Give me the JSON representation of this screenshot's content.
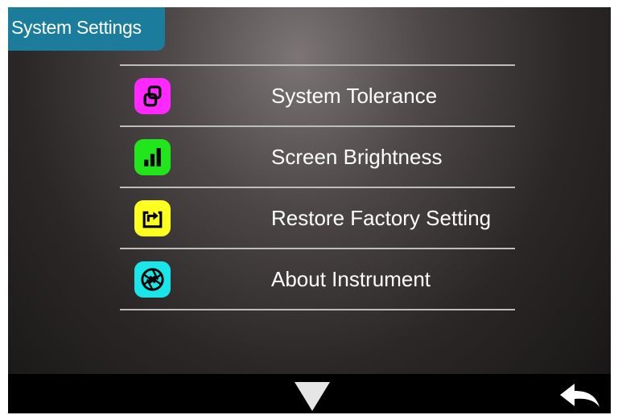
{
  "header": {
    "title": "System Settings"
  },
  "menu": {
    "items": [
      {
        "label": "System Tolerance",
        "icon": "tolerance-icon",
        "color": "#ff28ff"
      },
      {
        "label": "Screen Brightness",
        "icon": "brightness-bars-icon",
        "color": "#22e61c"
      },
      {
        "label": "Restore Factory Setting",
        "icon": "restore-icon",
        "color": "#ffff20"
      },
      {
        "label": "About Instrument",
        "icon": "aperture-icon",
        "color": "#1ae6ea"
      }
    ]
  },
  "footer": {
    "down_icon": "triangle-down-icon",
    "back_icon": "back-arrow-icon"
  },
  "colors": {
    "title_background": "#1b7c9c",
    "bottom_bar": "#000000",
    "divider": "#bdbdbd"
  }
}
